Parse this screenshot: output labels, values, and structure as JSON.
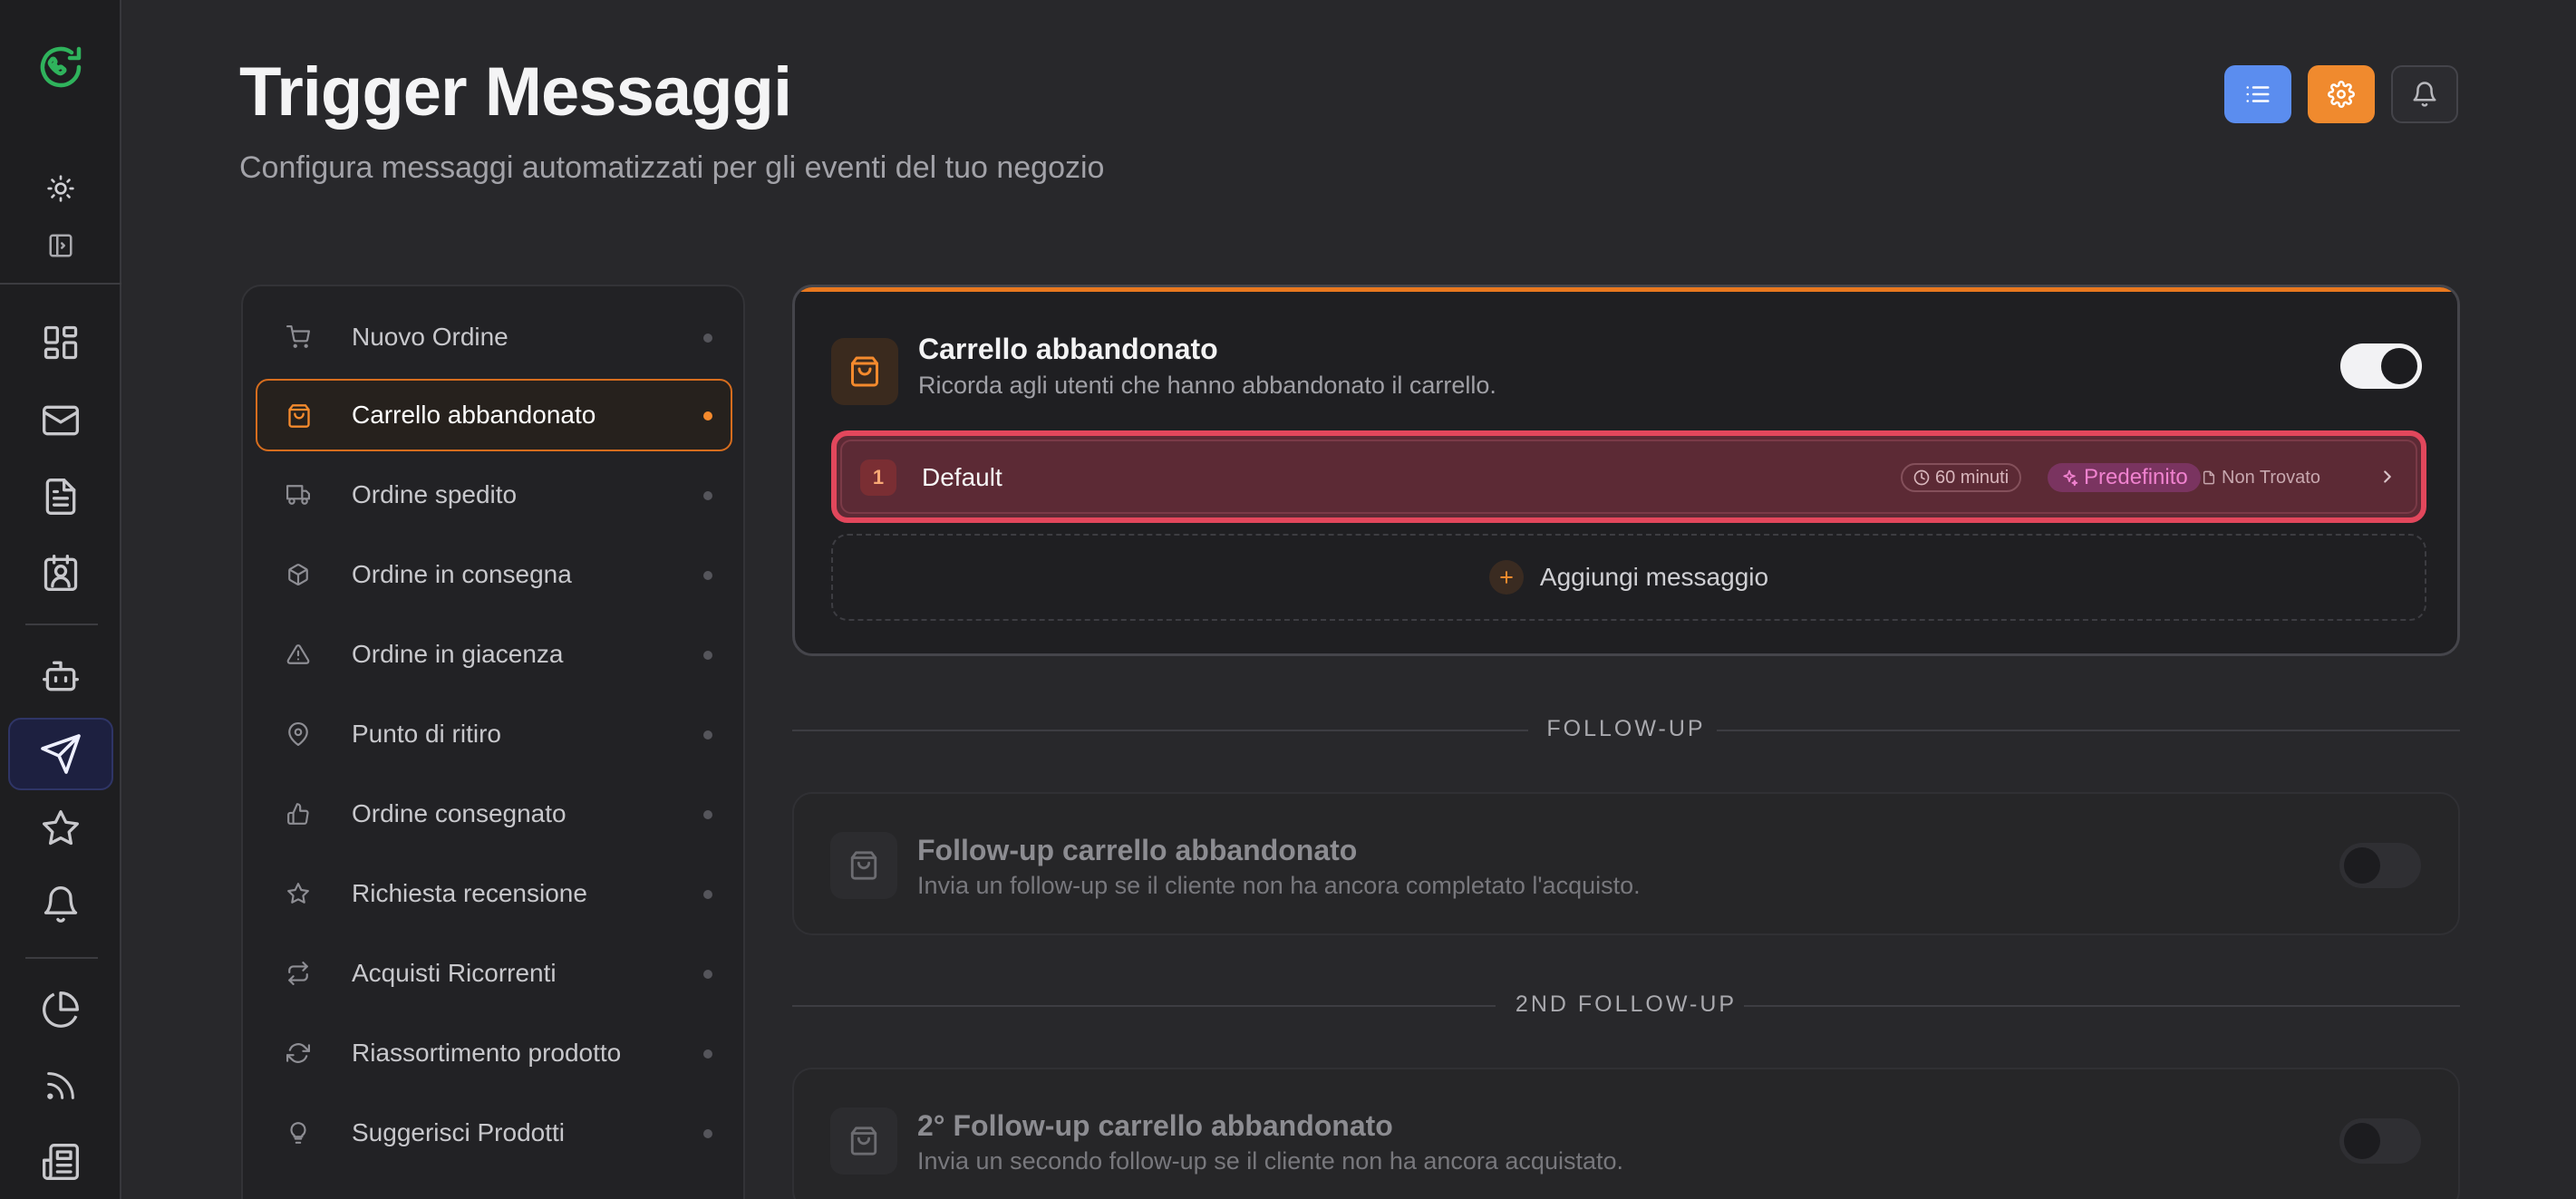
{
  "page": {
    "title": "Trigger Messaggi",
    "subtitle": "Configura messaggi automatizzati per gli eventi del tuo negozio"
  },
  "header_buttons": [
    {
      "name": "list-view-button",
      "icon": "list-icon",
      "color": "#5b8def"
    },
    {
      "name": "settings-button",
      "icon": "gear-icon",
      "color": "#f08a2e"
    },
    {
      "name": "notifications-button",
      "icon": "bell-icon",
      "color": "#2c2c30"
    }
  ],
  "rail": {
    "items": [
      "logo-icon",
      "theme-toggle-icon",
      "sidebar-toggle-icon",
      "dashboard-icon",
      "mail-icon",
      "document-icon",
      "contacts-icon",
      "bot-icon",
      "send-icon",
      "star-icon",
      "bell-icon",
      "pie-chart-icon",
      "rss-icon",
      "newspaper-icon"
    ],
    "active": "send-icon"
  },
  "menu": {
    "items": [
      {
        "label": "Nuovo Ordine",
        "icon": "cart-icon"
      },
      {
        "label": "Carrello abbandonato",
        "icon": "shopping-bag-icon",
        "selected": true
      },
      {
        "label": "Ordine spedito",
        "icon": "truck-icon"
      },
      {
        "label": "Ordine in consegna",
        "icon": "package-icon"
      },
      {
        "label": "Ordine in giacenza",
        "icon": "warning-icon"
      },
      {
        "label": "Punto di ritiro",
        "icon": "map-pin-icon"
      },
      {
        "label": "Ordine consegnato",
        "icon": "thumbs-up-icon"
      },
      {
        "label": "Richiesta recensione",
        "icon": "star-icon"
      },
      {
        "label": "Acquisti Ricorrenti",
        "icon": "repeat-icon"
      },
      {
        "label": "Riassortimento prodotto",
        "icon": "refresh-icon"
      },
      {
        "label": "Suggerisci Prodotti",
        "icon": "lightbulb-icon"
      }
    ]
  },
  "main_trigger": {
    "title": "Carrello abbandonato",
    "description": "Ricorda agli utenti che hanno abbandonato il carrello.",
    "enabled": true,
    "accent": "#e8781f",
    "message": {
      "index": "1",
      "name": "Default",
      "delay": "60 minuti",
      "badge": "Predefinito",
      "template_status": "Non Trovato"
    },
    "add_label": "Aggiungi messaggio"
  },
  "followups": [
    {
      "section": "FOLLOW-UP",
      "title": "Follow-up carrello abbandonato",
      "description": "Invia un follow-up se il cliente non ha ancora completato l'acquisto.",
      "enabled": false
    },
    {
      "section": "2ND FOLLOW-UP",
      "title": "2° Follow-up carrello abbandonato",
      "description": "Invia un secondo follow-up se il cliente non ha ancora acquistato.",
      "enabled": false
    }
  ]
}
